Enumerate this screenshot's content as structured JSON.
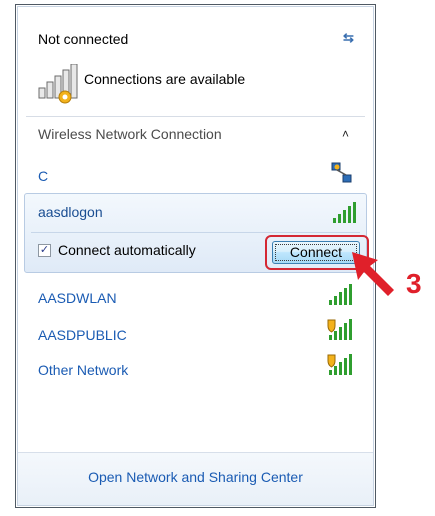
{
  "status": {
    "title": "Not connected",
    "availability": "Connections are available",
    "refresh_icon": "refresh-icon"
  },
  "section": {
    "title": "Wireless Network Connection",
    "toggle_glyph": "˄"
  },
  "networks": [
    {
      "name": "C",
      "icon": "wired-network-icon"
    },
    {
      "name": "aasdlogon",
      "icon": "signal-bars-icon",
      "selected": true
    },
    {
      "name": "AASDWLAN",
      "icon": "signal-bars-icon"
    },
    {
      "name": "AASDPUBLIC",
      "icon": "signal-bars-shield-icon"
    },
    {
      "name": "Other Network",
      "icon": "signal-bars-shield-icon"
    }
  ],
  "selected": {
    "auto_connect_label": "Connect automatically",
    "auto_connect_checked": true,
    "connect_label": "Connect"
  },
  "footer": {
    "link": "Open Network and Sharing Center"
  },
  "annotation": {
    "step": "3"
  },
  "colors": {
    "link": "#1a5bb3",
    "highlight": "#d42733",
    "annotation": "#e0202a"
  }
}
